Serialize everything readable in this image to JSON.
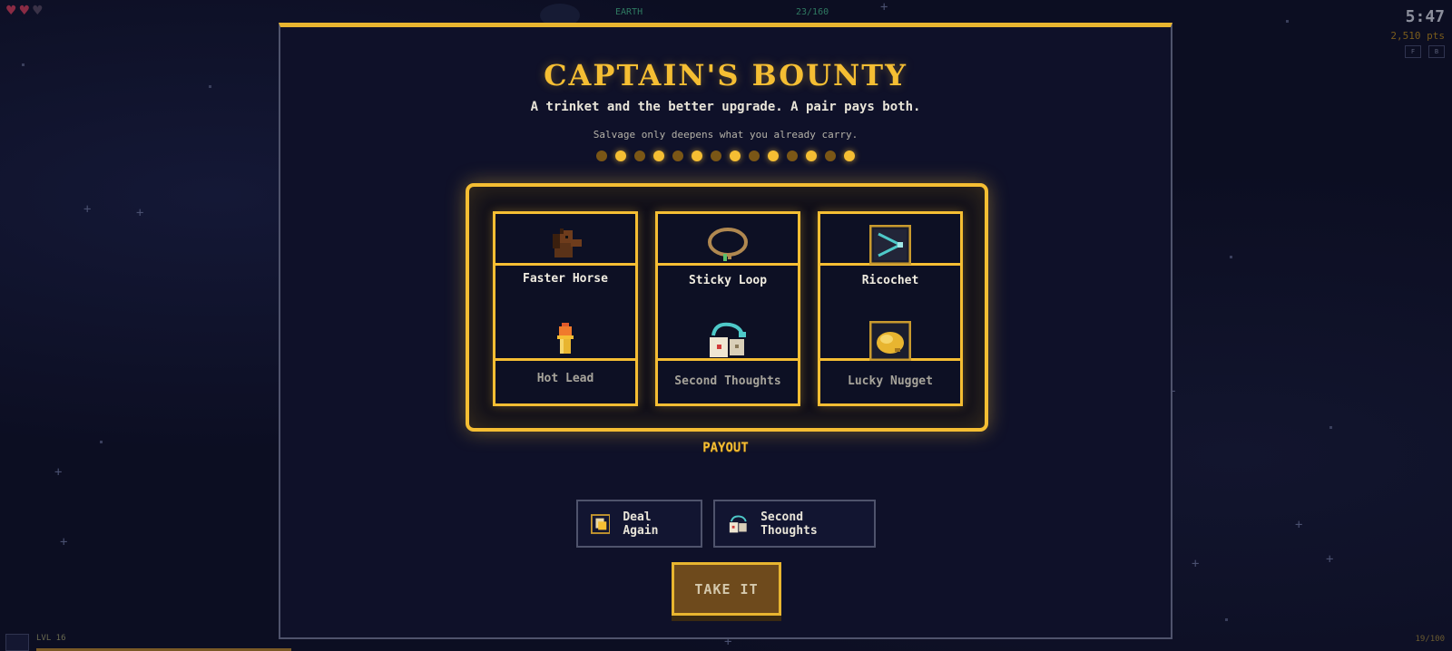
{
  "hud": {
    "hearts": {
      "filled": 2,
      "total": 3
    },
    "world_label": "EARTH",
    "wave_progress": "23/160",
    "timer": "5:47",
    "points": "2,510 pts",
    "keys": [
      "F",
      "B"
    ],
    "level": "LVL 16",
    "xp_progress": 0.18,
    "kill_count": "19/100"
  },
  "modal": {
    "title": "CAPTAIN'S BOUNTY",
    "subtitle": "A trinket and the better upgrade. A pair pays both.",
    "note": "Salvage only deepens what you already carry.",
    "pips": [
      false,
      true,
      false,
      true,
      false,
      true,
      false,
      true,
      false,
      true,
      false,
      true,
      false,
      true
    ],
    "reels": [
      {
        "top": {
          "label": "Faster Horse",
          "icon": "horse-icon"
        },
        "bottom": {
          "label": "Hot Lead",
          "icon": "bullet-icon"
        }
      },
      {
        "top": {
          "label": "Sticky Loop",
          "icon": "lasso-icon"
        },
        "bottom": {
          "label": "Second Thoughts",
          "icon": "reroll-icon"
        }
      },
      {
        "top": {
          "label": "Ricochet",
          "icon": "ricochet-icon"
        },
        "bottom": {
          "label": "Lucky Nugget",
          "icon": "nugget-icon"
        }
      }
    ],
    "payout_label": "PAYOUT",
    "buttons": {
      "deal_again": "Deal Again",
      "second_thoughts": "Second Thoughts",
      "take_it": "TAKE IT"
    }
  },
  "colors": {
    "accent": "#f5be33",
    "panel_bg": "#0f1129",
    "take_button": "#6e4a1c"
  }
}
